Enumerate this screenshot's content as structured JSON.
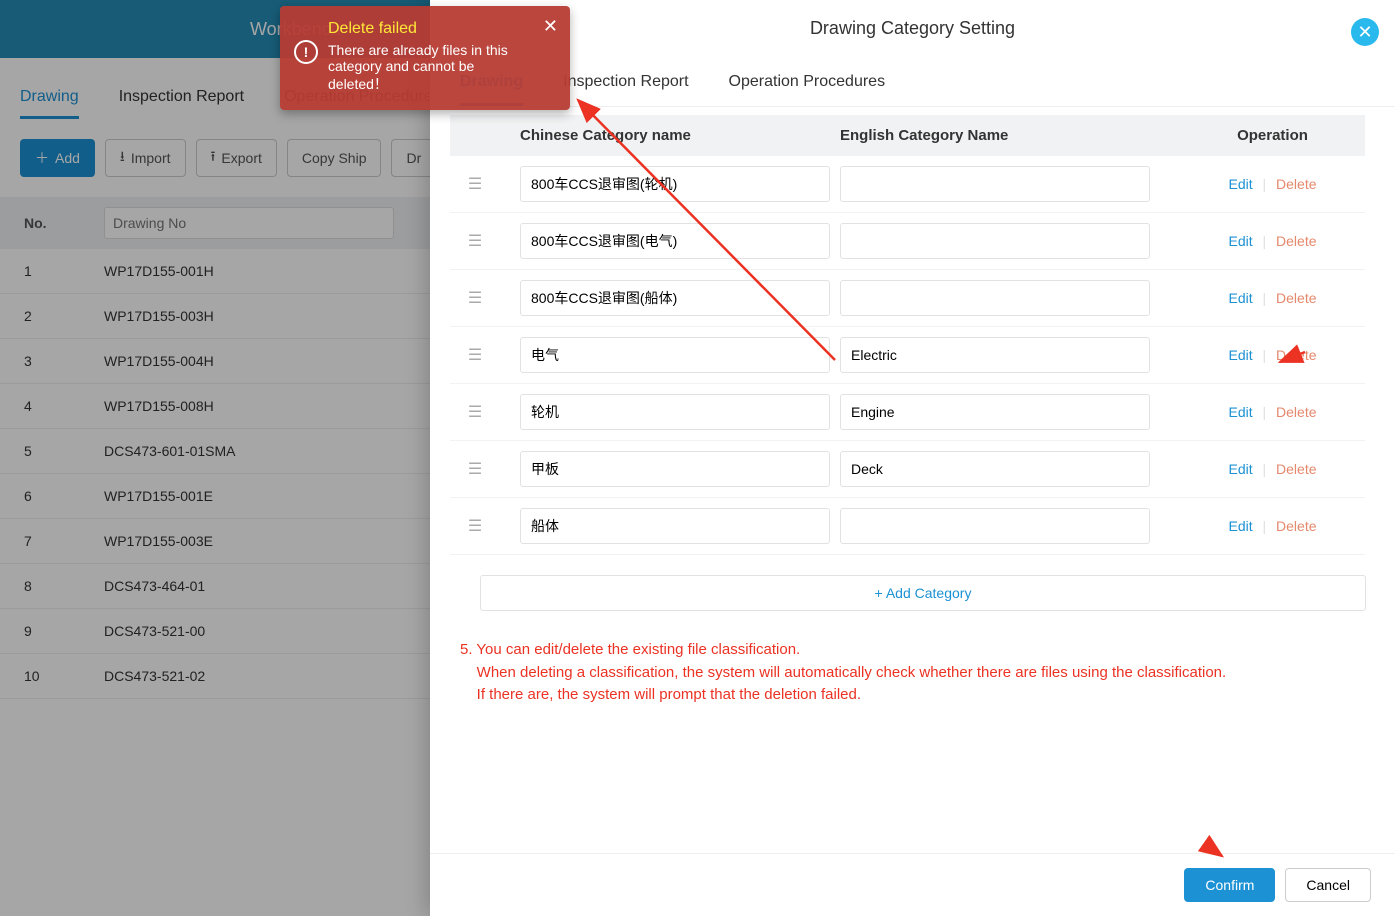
{
  "bg": {
    "header_title": "Workbench",
    "tabs": [
      "Drawing",
      "Inspection Report",
      "Operation Procedure"
    ],
    "actions": {
      "add": "Add",
      "import": "Import",
      "export": "Export",
      "copy_ship": "Copy Ship",
      "dr": "Dr"
    },
    "table": {
      "header_no": "No.",
      "filter_placeholder": "Drawing No",
      "rows": [
        {
          "no": "1",
          "drawingNo": "WP17D155-001H"
        },
        {
          "no": "2",
          "drawingNo": "WP17D155-003H"
        },
        {
          "no": "3",
          "drawingNo": "WP17D155-004H"
        },
        {
          "no": "4",
          "drawingNo": "WP17D155-008H"
        },
        {
          "no": "5",
          "drawingNo": "DCS473-601-01SMA"
        },
        {
          "no": "6",
          "drawingNo": "WP17D155-001E"
        },
        {
          "no": "7",
          "drawingNo": "WP17D155-003E"
        },
        {
          "no": "8",
          "drawingNo": "DCS473-464-01"
        },
        {
          "no": "9",
          "drawingNo": "DCS473-521-00"
        },
        {
          "no": "10",
          "drawingNo": "DCS473-521-02"
        }
      ]
    }
  },
  "toast": {
    "title": "Delete failed",
    "message": "There are already files in this category and cannot be deleted！"
  },
  "modal": {
    "title": "Drawing Category Setting",
    "tabs": [
      "Drawing",
      "Inspection Report",
      "Operation Procedures"
    ],
    "columns": {
      "cn": "Chinese Category name",
      "en": "English Category Name",
      "op": "Operation"
    },
    "op_edit": "Edit",
    "op_delete": "Delete",
    "rows": [
      {
        "cn": "800车CCS退审图(轮机)",
        "en": ""
      },
      {
        "cn": "800车CCS退审图(电气)",
        "en": ""
      },
      {
        "cn": "800车CCS退审图(船体)",
        "en": ""
      },
      {
        "cn": "电气",
        "en": "Electric"
      },
      {
        "cn": "轮机",
        "en": "Engine"
      },
      {
        "cn": "甲板",
        "en": "Deck"
      },
      {
        "cn": "船体",
        "en": ""
      }
    ],
    "add_category": "+ Add Category",
    "instruction_prefix": "5. ",
    "instruction_line1": "You can edit/delete the existing file classification.",
    "instruction_line2": "When deleting a classification, the system will automatically check whether there are files using the classification.",
    "instruction_line3": "If there are, the system will prompt that the deletion failed.",
    "confirm": "Confirm",
    "cancel": "Cancel"
  }
}
